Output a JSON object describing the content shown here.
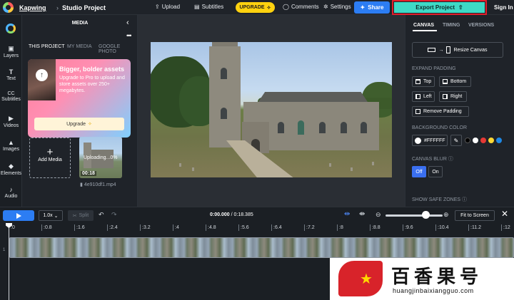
{
  "header": {
    "brand": "Kapwing",
    "separator": "›",
    "project": "Studio Project",
    "caret": "⌄",
    "upload": "Upload",
    "subtitles": "Subtitles",
    "upgrade": "UPGRADE",
    "comments": "Comments",
    "settings": "Settings",
    "share": "Share",
    "export": "Export Project",
    "signin": "Sign In"
  },
  "rail": {
    "items": [
      {
        "icon": "▣",
        "label": "Layers"
      },
      {
        "icon": "T",
        "label": "Text"
      },
      {
        "icon": "CC",
        "label": "Subtitles"
      },
      {
        "icon": "▶",
        "label": "Videos"
      },
      {
        "icon": "▲",
        "label": "Images"
      },
      {
        "icon": "◆",
        "label": "Elements"
      },
      {
        "icon": "♪",
        "label": "Audio"
      }
    ]
  },
  "media": {
    "title": "MEDIA",
    "close": "‹",
    "more": "•••",
    "tabs": [
      "THIS PROJECT",
      "MY MEDIA",
      "GOOGLE PHOTO"
    ],
    "promo": {
      "heading": "Bigger, bolder assets",
      "text": "Upgrade to Pro to upload and store assets over 250+ megabytes.",
      "button": "Upgrade",
      "button_icon": "✧"
    },
    "add_media": "Add Media",
    "add_icon": "+",
    "file": {
      "status": "Uploading...0%",
      "duration": "00:18",
      "name": "4e910df1.mp4"
    }
  },
  "settings_panel": {
    "tabs": [
      "CANVAS",
      "TIMING",
      "VERSIONS"
    ],
    "resize": "Resize Canvas",
    "expand_padding": "EXPAND PADDING",
    "padding": {
      "top": "Top",
      "bottom": "Bottom",
      "left": "Left",
      "right": "Right",
      "remove": "Remove Padding"
    },
    "background_color": "BACKGROUND COLOR",
    "color_value": "#FFFFFF",
    "picker_icon": "✎",
    "swatches": [
      "#000000",
      "#ffffff",
      "#e53935",
      "#fdd835",
      "#1e88e5"
    ],
    "canvas_blur": "CANVAS BLUR",
    "info_icon": "ⓘ",
    "blur_off": "Off",
    "blur_on": "On",
    "safe_zones": "SHOW SAFE ZONES"
  },
  "timeline": {
    "speed": "1.0x",
    "speed_caret": "⌄",
    "split": "Split",
    "split_icon": "✂",
    "undo": "↶",
    "redo": "↷",
    "current_time": "0:00.000",
    "total_time": "/ 0:18.385",
    "zoom_out": "⊖",
    "zoom_in": "⊕",
    "fit": "Fit to Screen",
    "close": "✕",
    "track_label": "1",
    "ticks": [
      ":0",
      ":0.8",
      ":1.6",
      ":2.4",
      ":3.2",
      ":4",
      ":4.8",
      ":5.6",
      ":6.4",
      ":7.2",
      ":8",
      ":8.8",
      ":9.6",
      ":10.4",
      ":11.2",
      ":12"
    ]
  },
  "watermark": {
    "title": "百香果号",
    "url": "huangjinbaixiangguo.com"
  }
}
